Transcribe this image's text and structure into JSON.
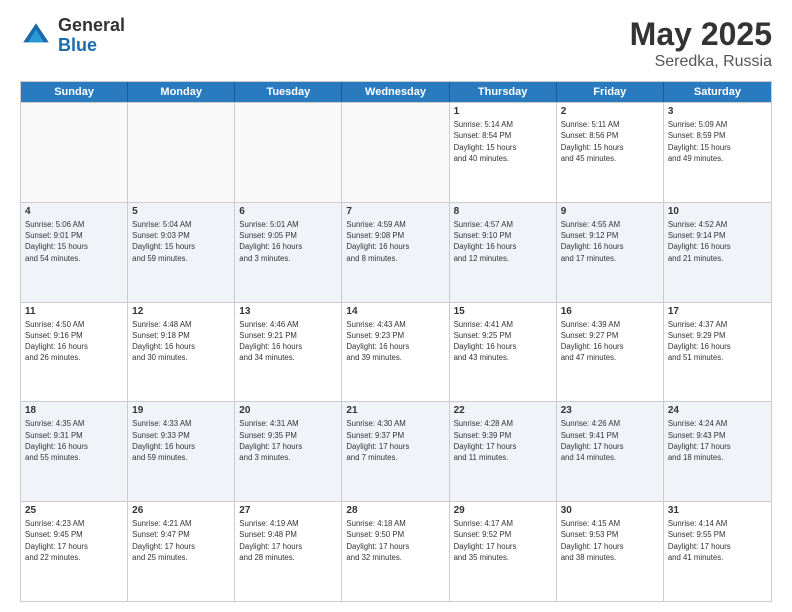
{
  "logo": {
    "general": "General",
    "blue": "Blue"
  },
  "title": {
    "month": "May 2025",
    "location": "Seredka, Russia"
  },
  "header_days": [
    "Sunday",
    "Monday",
    "Tuesday",
    "Wednesday",
    "Thursday",
    "Friday",
    "Saturday"
  ],
  "rows": [
    [
      {
        "day": "",
        "info": "",
        "empty": true
      },
      {
        "day": "",
        "info": "",
        "empty": true
      },
      {
        "day": "",
        "info": "",
        "empty": true
      },
      {
        "day": "",
        "info": "",
        "empty": true
      },
      {
        "day": "1",
        "info": "Sunrise: 5:14 AM\nSunset: 8:54 PM\nDaylight: 15 hours\nand 40 minutes."
      },
      {
        "day": "2",
        "info": "Sunrise: 5:11 AM\nSunset: 8:56 PM\nDaylight: 15 hours\nand 45 minutes."
      },
      {
        "day": "3",
        "info": "Sunrise: 5:09 AM\nSunset: 8:59 PM\nDaylight: 15 hours\nand 49 minutes."
      }
    ],
    [
      {
        "day": "4",
        "info": "Sunrise: 5:06 AM\nSunset: 9:01 PM\nDaylight: 15 hours\nand 54 minutes."
      },
      {
        "day": "5",
        "info": "Sunrise: 5:04 AM\nSunset: 9:03 PM\nDaylight: 15 hours\nand 59 minutes."
      },
      {
        "day": "6",
        "info": "Sunrise: 5:01 AM\nSunset: 9:05 PM\nDaylight: 16 hours\nand 3 minutes."
      },
      {
        "day": "7",
        "info": "Sunrise: 4:59 AM\nSunset: 9:08 PM\nDaylight: 16 hours\nand 8 minutes."
      },
      {
        "day": "8",
        "info": "Sunrise: 4:57 AM\nSunset: 9:10 PM\nDaylight: 16 hours\nand 12 minutes."
      },
      {
        "day": "9",
        "info": "Sunrise: 4:55 AM\nSunset: 9:12 PM\nDaylight: 16 hours\nand 17 minutes."
      },
      {
        "day": "10",
        "info": "Sunrise: 4:52 AM\nSunset: 9:14 PM\nDaylight: 16 hours\nand 21 minutes."
      }
    ],
    [
      {
        "day": "11",
        "info": "Sunrise: 4:50 AM\nSunset: 9:16 PM\nDaylight: 16 hours\nand 26 minutes."
      },
      {
        "day": "12",
        "info": "Sunrise: 4:48 AM\nSunset: 9:18 PM\nDaylight: 16 hours\nand 30 minutes."
      },
      {
        "day": "13",
        "info": "Sunrise: 4:46 AM\nSunset: 9:21 PM\nDaylight: 16 hours\nand 34 minutes."
      },
      {
        "day": "14",
        "info": "Sunrise: 4:43 AM\nSunset: 9:23 PM\nDaylight: 16 hours\nand 39 minutes."
      },
      {
        "day": "15",
        "info": "Sunrise: 4:41 AM\nSunset: 9:25 PM\nDaylight: 16 hours\nand 43 minutes."
      },
      {
        "day": "16",
        "info": "Sunrise: 4:39 AM\nSunset: 9:27 PM\nDaylight: 16 hours\nand 47 minutes."
      },
      {
        "day": "17",
        "info": "Sunrise: 4:37 AM\nSunset: 9:29 PM\nDaylight: 16 hours\nand 51 minutes."
      }
    ],
    [
      {
        "day": "18",
        "info": "Sunrise: 4:35 AM\nSunset: 9:31 PM\nDaylight: 16 hours\nand 55 minutes."
      },
      {
        "day": "19",
        "info": "Sunrise: 4:33 AM\nSunset: 9:33 PM\nDaylight: 16 hours\nand 59 minutes."
      },
      {
        "day": "20",
        "info": "Sunrise: 4:31 AM\nSunset: 9:35 PM\nDaylight: 17 hours\nand 3 minutes."
      },
      {
        "day": "21",
        "info": "Sunrise: 4:30 AM\nSunset: 9:37 PM\nDaylight: 17 hours\nand 7 minutes."
      },
      {
        "day": "22",
        "info": "Sunrise: 4:28 AM\nSunset: 9:39 PM\nDaylight: 17 hours\nand 11 minutes."
      },
      {
        "day": "23",
        "info": "Sunrise: 4:26 AM\nSunset: 9:41 PM\nDaylight: 17 hours\nand 14 minutes."
      },
      {
        "day": "24",
        "info": "Sunrise: 4:24 AM\nSunset: 9:43 PM\nDaylight: 17 hours\nand 18 minutes."
      }
    ],
    [
      {
        "day": "25",
        "info": "Sunrise: 4:23 AM\nSunset: 9:45 PM\nDaylight: 17 hours\nand 22 minutes."
      },
      {
        "day": "26",
        "info": "Sunrise: 4:21 AM\nSunset: 9:47 PM\nDaylight: 17 hours\nand 25 minutes."
      },
      {
        "day": "27",
        "info": "Sunrise: 4:19 AM\nSunset: 9:48 PM\nDaylight: 17 hours\nand 28 minutes."
      },
      {
        "day": "28",
        "info": "Sunrise: 4:18 AM\nSunset: 9:50 PM\nDaylight: 17 hours\nand 32 minutes."
      },
      {
        "day": "29",
        "info": "Sunrise: 4:17 AM\nSunset: 9:52 PM\nDaylight: 17 hours\nand 35 minutes."
      },
      {
        "day": "30",
        "info": "Sunrise: 4:15 AM\nSunset: 9:53 PM\nDaylight: 17 hours\nand 38 minutes."
      },
      {
        "day": "31",
        "info": "Sunrise: 4:14 AM\nSunset: 9:55 PM\nDaylight: 17 hours\nand 41 minutes."
      }
    ]
  ]
}
